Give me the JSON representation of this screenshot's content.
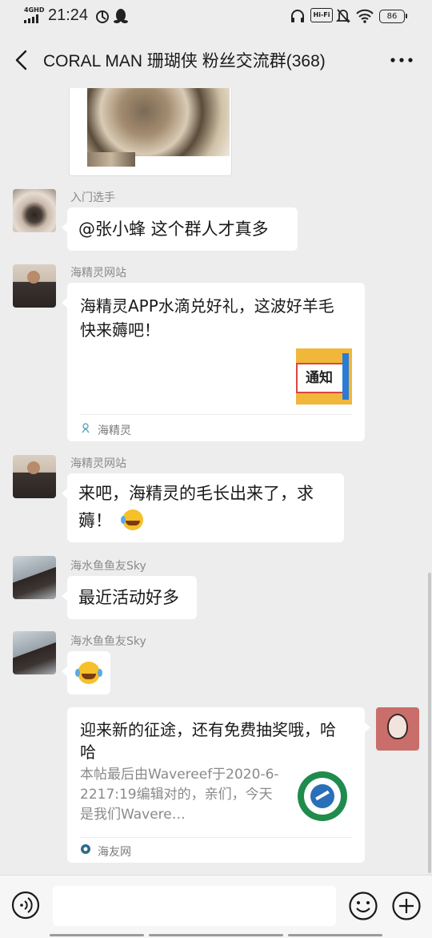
{
  "status_bar": {
    "network": "4GHD",
    "time": "21:24",
    "hifi": "Hi-Fi",
    "battery": "86"
  },
  "header": {
    "title": "CORAL MAN 珊瑚侠 粉丝交流群(368)"
  },
  "messages": [
    {
      "sender": "入门选手",
      "text": "@张小蜂  这个群人才真多"
    },
    {
      "sender": "海精灵网站",
      "card_title": "海精灵APP水滴兑好礼，这波好羊毛快来薅吧！",
      "thumb_text": "通知",
      "source": "海精灵"
    },
    {
      "sender": "海精灵网站",
      "text": "来吧，海精灵的毛长出来了，求薅！"
    },
    {
      "sender": "海水鱼鱼友Sky",
      "text": "最近活动好多"
    },
    {
      "sender": "海水鱼鱼友Sky",
      "emoji": "😂"
    },
    {
      "card_title": "迎来新的征途，还有免费抽奖哦，哈哈",
      "card_desc": "本帖最后由Wavereef于2020-6-2217:19编辑对的，亲们，今天是我们Wavere…",
      "source": "海友网"
    }
  ],
  "icons": {
    "back": "back-arrow-icon",
    "more": "more-dots-icon",
    "voice": "voice-icon",
    "emoji": "emoji-icon",
    "plus": "plus-icon"
  },
  "colors": {
    "background": "#ededed",
    "bubble": "#ffffff",
    "sender_name": "#8a8a8a"
  }
}
